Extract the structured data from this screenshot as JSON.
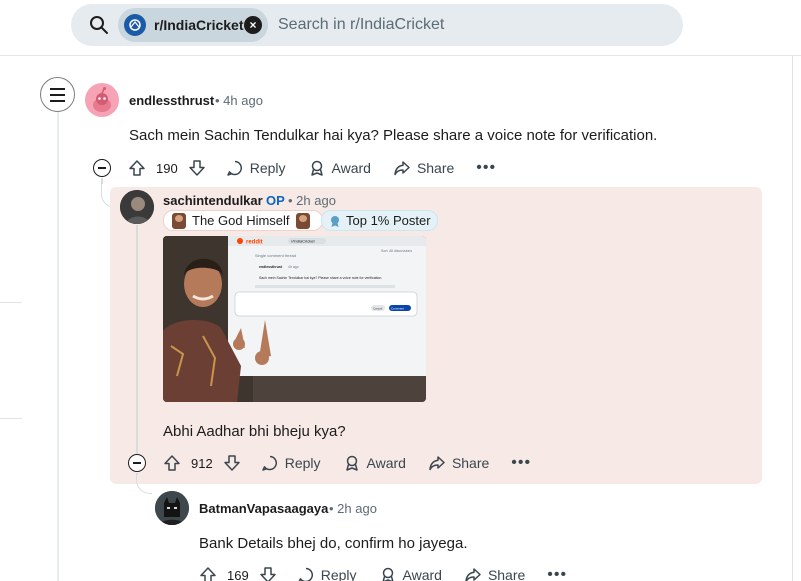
{
  "search": {
    "subreddit": "r/IndiaCricket",
    "placeholder": "Search in r/IndiaCricket"
  },
  "comments": [
    {
      "username": "endlessthrust",
      "time": "• 4h ago",
      "text": "Sach mein Sachin Tendulkar hai kya? Please share a voice note for verification.",
      "votes": "190",
      "reply": "Reply",
      "award": "Award",
      "share": "Share",
      "more": "•••"
    },
    {
      "username": "sachintendulkar",
      "op": "OP",
      "time": "• 2h ago",
      "flair1": "The God Himself",
      "flair2": "Top 1% Poster",
      "image_alt": "Photo of Sachin pointing at a screen showing the Reddit comment",
      "screen": {
        "brand": "reddit",
        "chip": "r/IndiaCricket",
        "tab": "Sort: All discussions",
        "thread": "Single comment thread",
        "comment_user": "endlessthrust",
        "comment_time": "4h ago",
        "comment_text": "Sach mein Sachin Tendulkar hai kya? Please share a voice note for verification.",
        "cancel": "Cancel",
        "comment_btn": "Comment"
      },
      "text": "Abhi Aadhar bhi bheju kya?",
      "votes": "912",
      "reply": "Reply",
      "award": "Award",
      "share": "Share",
      "more": "•••"
    },
    {
      "username": "BatmanVapasaagaya",
      "time": "• 2h ago",
      "text": "Bank Details bhej do, confirm ho jayega.",
      "votes": "169",
      "reply": "Reply",
      "award": "Award",
      "share": "Share",
      "more": "•••"
    }
  ],
  "colors": {
    "highlight": "#f7e9e6",
    "op": "#0a66c2",
    "search_bg": "#e5ebee",
    "chip_bg": "#c9d6dd"
  }
}
